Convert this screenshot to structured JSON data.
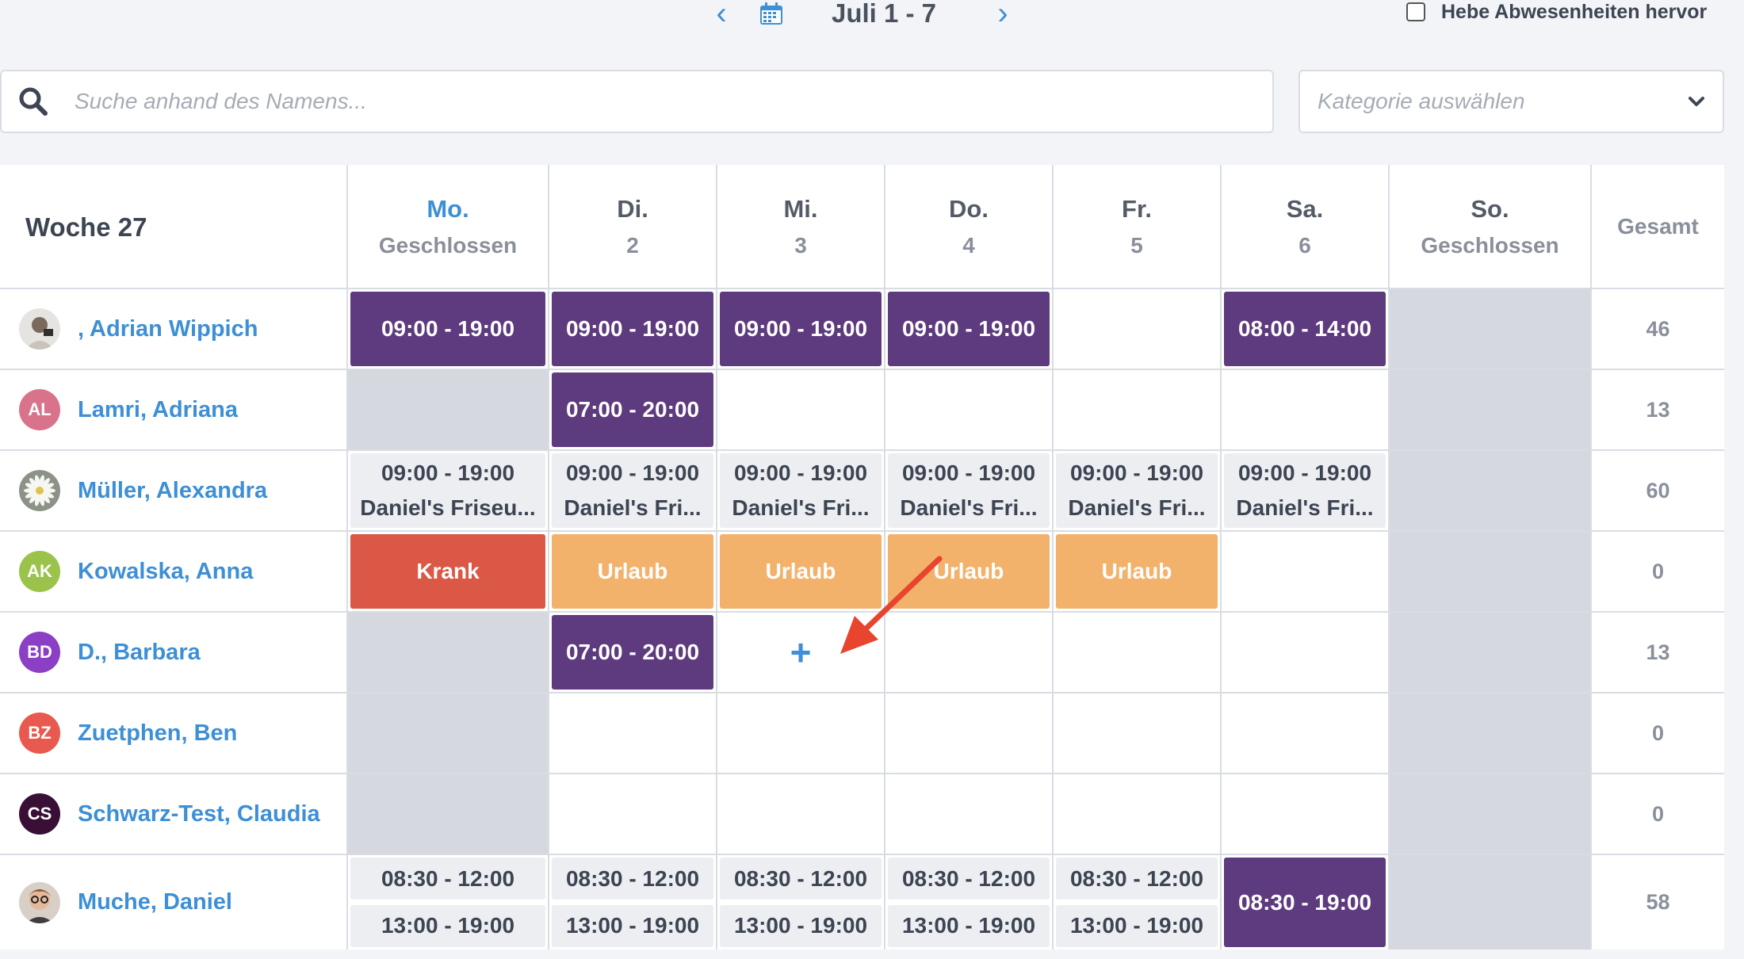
{
  "nav": {
    "prev": "‹",
    "next": "›",
    "date_range": "Juli 1 - 7",
    "highlight_label": "Hebe Abwesenheiten hervor"
  },
  "search": {
    "placeholder": "Suche anhand des Namens..."
  },
  "category": {
    "placeholder": "Kategorie auswählen"
  },
  "header": {
    "week": "Woche 27",
    "days": [
      {
        "name": "Mo.",
        "sub": "Geschlossen"
      },
      {
        "name": "Di.",
        "sub": "2"
      },
      {
        "name": "Mi.",
        "sub": "3"
      },
      {
        "name": "Do.",
        "sub": "4"
      },
      {
        "name": "Fr.",
        "sub": "5"
      },
      {
        "name": "Sa.",
        "sub": "6"
      },
      {
        "name": "So.",
        "sub": "Geschlossen"
      }
    ],
    "total": "Gesamt"
  },
  "employees": [
    {
      "name": ", Adrian Wippich",
      "initials": "",
      "total": "46",
      "shifts": [
        "09:00 - 19:00",
        "09:00 - 19:00",
        "09:00 - 19:00",
        "09:00 - 19:00",
        "",
        "08:00 - 14:00",
        ""
      ]
    },
    {
      "name": "Lamri, Adriana",
      "initials": "AL",
      "total": "13",
      "shifts": [
        "",
        "07:00 - 20:00",
        "",
        "",
        "",
        "",
        ""
      ]
    },
    {
      "name": "Müller, Alexandra",
      "initials": "",
      "total": "60",
      "shifts": [
        "09:00 - 19:00",
        "09:00 - 19:00",
        "09:00 - 19:00",
        "09:00 - 19:00",
        "09:00 - 19:00",
        "09:00 - 19:00",
        ""
      ],
      "locations": [
        "Daniel's Friseu...",
        "Daniel's Fri...",
        "Daniel's Fri...",
        "Daniel's Fri...",
        "Daniel's Fri...",
        "Daniel's Fri...",
        ""
      ]
    },
    {
      "name": "Kowalska, Anna",
      "initials": "AK",
      "total": "0",
      "shifts": [
        "Krank",
        "Urlaub",
        "Urlaub",
        "Urlaub",
        "Urlaub",
        "",
        ""
      ]
    },
    {
      "name": "D., Barbara",
      "initials": "BD",
      "total": "13",
      "shifts": [
        "",
        "07:00 - 20:00",
        "+",
        "",
        "",
        "",
        ""
      ]
    },
    {
      "name": "Zuetphen, Ben",
      "initials": "BZ",
      "total": "0",
      "shifts": [
        "",
        "",
        "",
        "",
        "",
        "",
        ""
      ]
    },
    {
      "name": "Schwarz-Test, Claudia",
      "initials": "CS",
      "total": "0",
      "shifts": [
        "",
        "",
        "",
        "",
        "",
        "",
        ""
      ]
    },
    {
      "name": "Muche, Daniel",
      "initials": "",
      "total": "58",
      "shifts": [
        "08:30 - 12:00",
        "08:30 - 12:00",
        "08:30 - 12:00",
        "08:30 - 12:00",
        "08:30 - 12:00",
        "08:30 - 19:00",
        ""
      ],
      "shifts_pm": [
        "13:00 - 19:00",
        "13:00 - 19:00",
        "13:00 - 19:00",
        "13:00 - 19:00",
        "13:00 - 19:00",
        "",
        ""
      ]
    }
  ],
  "colors": {
    "accent": "#3d8fd6",
    "shift_purple": "#5e3a7e",
    "sick_red": "#da5845",
    "vacation_orange": "#f2b26b",
    "avatar_al": "#d9728b",
    "avatar_ak": "#9bc24a",
    "avatar_bd": "#8a3fc4",
    "avatar_bz": "#e85a4f",
    "avatar_cs": "#3a0f36"
  }
}
